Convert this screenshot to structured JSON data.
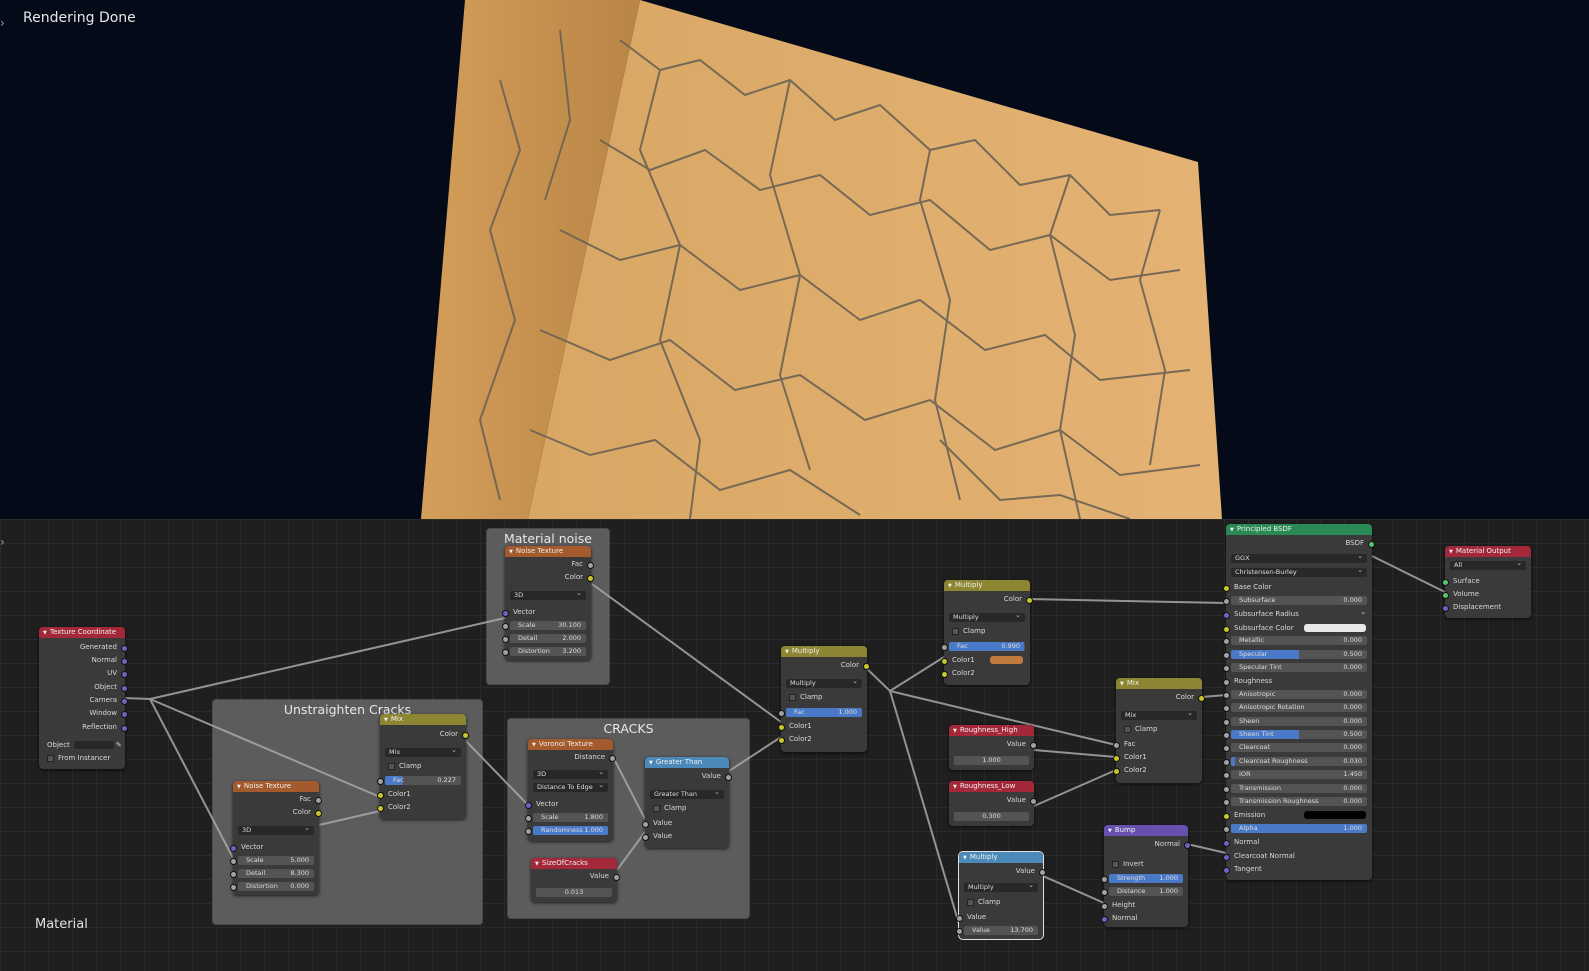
{
  "render": {
    "status": "Rendering Done"
  },
  "editor": {
    "material_label": "Material"
  },
  "frames": {
    "material_noise": "Material noise",
    "unstraighten": "Unstraighten Cracks",
    "cracks": "CRACKS"
  },
  "nodes": {
    "texcoord": {
      "title": "Texture Coordinate",
      "outputs": [
        "Generated",
        "Normal",
        "UV",
        "Object",
        "Camera",
        "Window",
        "Reflection"
      ],
      "object_label": "Object",
      "from_instancer": "From Instancer"
    },
    "noise_material": {
      "title": "Noise Texture",
      "out_fac": "Fac",
      "out_color": "Color",
      "dim": "3D",
      "vector": "Vector",
      "scale_label": "Scale",
      "scale": "30.100",
      "detail_label": "Detail",
      "detail": "2.000",
      "distortion_label": "Distortion",
      "distortion": "3.200"
    },
    "noise_unstraighten": {
      "title": "Noise Texture",
      "out_fac": "Fac",
      "out_color": "Color",
      "dim": "3D",
      "vector": "Vector",
      "scale_label": "Scale",
      "scale": "5.000",
      "detail_label": "Detail",
      "detail": "8.300",
      "distortion_label": "Distortion",
      "distortion": "0.000"
    },
    "mix_unstraighten": {
      "title": "Mix",
      "out_color": "Color",
      "mode": "Mix",
      "clamp": "Clamp",
      "fac_label": "Fac",
      "fac": "0.227",
      "fac_fraction": 0.227,
      "color1": "Color1",
      "color2": "Color2"
    },
    "voronoi": {
      "title": "Voronoi Texture",
      "out_distance": "Distance",
      "dim": "3D",
      "feature": "Distance To Edge",
      "vector": "Vector",
      "scale_label": "Scale",
      "scale": "1.800",
      "rand_label": "Randomness",
      "randomness": "1.000",
      "rand_fraction": 1.0
    },
    "greater_than": {
      "title": "Greater Than",
      "out_value": "Value",
      "op": "Greater Than",
      "clamp": "Clamp",
      "in1": "Value",
      "in2": "Value"
    },
    "size_of_cracks": {
      "title": "SizeOfCracks",
      "out_value": "Value",
      "value": "0.013"
    },
    "multiply_main": {
      "title": "Multiply",
      "out_color": "Color",
      "mode": "Multiply",
      "clamp": "Clamp",
      "fac_label": "Fac",
      "fac": "1.000",
      "fac_fraction": 1.0,
      "color1": "Color1",
      "color2": "Color2"
    },
    "multiply_color": {
      "title": "Multiply",
      "out_color": "Color",
      "mode": "Multiply",
      "clamp": "Clamp",
      "fac_label": "Fac",
      "fac": "0.990",
      "fac_fraction": 0.99,
      "color1": "Color1",
      "color2": "Color2",
      "swatch": "#c07a3c"
    },
    "roughness_high": {
      "title": "Roughness_High",
      "out_value": "Value",
      "value": "1.000"
    },
    "roughness_low": {
      "title": "Roughness_Low",
      "out_value": "Value",
      "value": "0.300"
    },
    "multiply_math": {
      "title": "Multiply",
      "out_value": "Value",
      "op": "Multiply",
      "clamp": "Clamp",
      "in1": "Value",
      "in2_label": "Value",
      "in2": "13.700"
    },
    "mix_rough": {
      "title": "Mix",
      "out_color": "Color",
      "mode": "Mix",
      "clamp": "Clamp",
      "fac": "Fac",
      "color1": "Color1",
      "color2": "Color2"
    },
    "bump": {
      "title": "Bump",
      "out_normal": "Normal",
      "invert": "Invert",
      "strength_label": "Strength",
      "strength": "1.000",
      "strength_fraction": 1.0,
      "distance_label": "Distance",
      "distance": "1.000",
      "height": "Height",
      "normal": "Normal"
    },
    "bsdf": {
      "title": "Principled BSDF",
      "out": "BSDF",
      "distribution": "GGX",
      "subsurface_method": "Christensen-Burley",
      "base_color": "Base Color",
      "rows": [
        {
          "label": "Subsurface",
          "value": "0.000",
          "fraction": 0
        },
        {
          "label": "Subsurface Radius",
          "value": "",
          "fraction": 0,
          "dropdown": true
        },
        {
          "label": "Subsurface Color",
          "value": "",
          "fraction": 0,
          "swatch": "#e8e8e8"
        },
        {
          "label": "Metallic",
          "value": "0.000",
          "fraction": 0
        },
        {
          "label": "Specular",
          "value": "0.500",
          "fraction": 0.5
        },
        {
          "label": "Specular Tint",
          "value": "0.000",
          "fraction": 0
        },
        {
          "label": "Roughness",
          "value": "",
          "fraction": 0,
          "plain": true
        },
        {
          "label": "Anisotropic",
          "value": "0.000",
          "fraction": 0
        },
        {
          "label": "Anisotropic Rotation",
          "value": "0.000",
          "fraction": 0
        },
        {
          "label": "Sheen",
          "value": "0.000",
          "fraction": 0
        },
        {
          "label": "Sheen Tint",
          "value": "0.500",
          "fraction": 0.5
        },
        {
          "label": "Clearcoat",
          "value": "0.000",
          "fraction": 0
        },
        {
          "label": "Clearcoat Roughness",
          "value": "0.030",
          "fraction": 0.03
        },
        {
          "label": "IOR",
          "value": "1.450",
          "fraction": 0
        },
        {
          "label": "Transmission",
          "value": "0.000",
          "fraction": 0
        },
        {
          "label": "Transmission Roughness",
          "value": "0.000",
          "fraction": 0
        },
        {
          "label": "Emission",
          "value": "",
          "fraction": 0,
          "swatch": "#000000"
        },
        {
          "label": "Alpha",
          "value": "1.000",
          "fraction": 1.0
        },
        {
          "label": "Normal",
          "value": "",
          "fraction": 0,
          "plain": true
        },
        {
          "label": "Clearcoat Normal",
          "value": "",
          "fraction": 0,
          "plain": true
        },
        {
          "label": "Tangent",
          "value": "",
          "fraction": 0,
          "plain": true
        }
      ]
    },
    "output": {
      "title": "Material Output",
      "target": "All",
      "surface": "Surface",
      "volume": "Volume",
      "displacement": "Displacement"
    }
  }
}
